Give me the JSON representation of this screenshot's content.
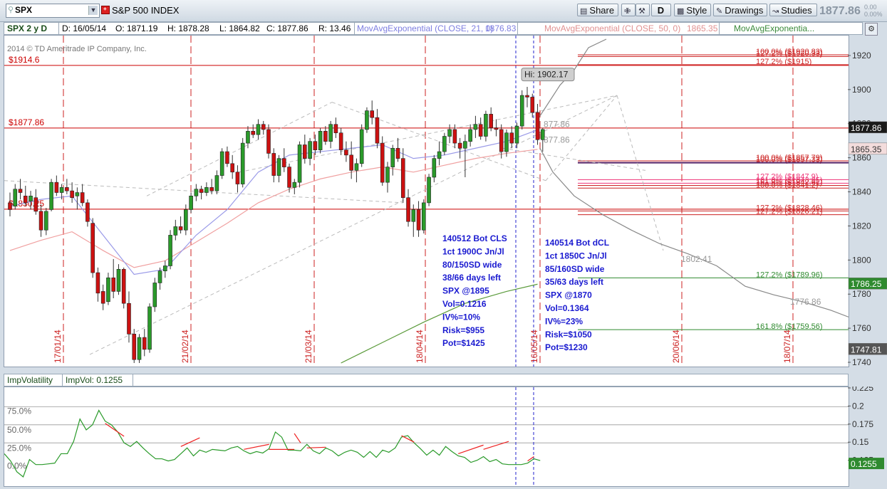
{
  "toolbar": {
    "symbol": "SPX",
    "index_name": "S&P 500 INDEX",
    "share_label": "Share",
    "d_label": "D",
    "style_label": "Style",
    "drawings_label": "Drawings",
    "studies_label": "Studies",
    "last_price": "1877.86",
    "change_abs": "0.00",
    "change_pct": "0.00%"
  },
  "header": {
    "period": "SPX 2 y D",
    "date": "D: 16/05/14",
    "open": "O: 1871.19",
    "high": "H: 1878.28",
    "low": "L: 1864.82",
    "close": "C: 1877.86",
    "range": "R: 13.46",
    "ema21_label": "MovAvgExponential (CLOSE, 21, 0)",
    "ema21_value": "1876.83",
    "ema50_label": "MovAvgExponential (CLOSE, 50, 0)",
    "ema50_value": "1865.35",
    "ema_other_label": "MovAvgExponentia..."
  },
  "chart_data": [
    {
      "type": "candlestick",
      "copyright": "2014 © TD Ameritrade IP Company, Inc.",
      "ylim": [
        1740,
        1930
      ],
      "y_ticks": [
        1740,
        1760,
        1780,
        1800,
        1820,
        1840,
        1860,
        1880,
        1900,
        1920
      ],
      "x_date_labels": [
        "17/01/14",
        "21/02/14",
        "21/03/14",
        "18/04/14",
        "16/05/14",
        "20/06/14",
        "18/07/14"
      ],
      "price_tags": [
        {
          "value": "1877.86",
          "color": "#1a1a1a"
        },
        {
          "value": "1865.35",
          "color": "#f3dcdc"
        },
        {
          "value": "1786.25",
          "color": "#2f8a2f"
        },
        {
          "value": "1747.81",
          "color": "#555555"
        }
      ],
      "hi_callout": "Hi: 1902.17",
      "level_lines": [
        {
          "label": "$1914.6",
          "value": 1914.6,
          "color": "#cc0000"
        },
        {
          "label": "$1877.86",
          "value": 1877.86,
          "color": "#cc0000"
        },
        {
          "label": "$1830.25",
          "value": 1830.25,
          "color": "#cc0000"
        }
      ],
      "fib_labels": [
        {
          "text": "100.0%  ($1920.83)",
          "value": 1920.8,
          "color": "#cc2222"
        },
        {
          "text": "127.2%  ($1920.33)",
          "value": 1919.8,
          "color": "#cc2222"
        },
        {
          "text": "127.2%  ($1915)",
          "value": 1915,
          "color": "#cc2222"
        },
        {
          "text": "100.0%  ($1857.79)",
          "value": 1858.6,
          "color": "#cc2222"
        },
        {
          "text": "100.0%  ($1857.33)",
          "value": 1857.5,
          "color": "#cc2222"
        },
        {
          "text": "127.2%  ($1847.9)",
          "value": 1847.6,
          "color": "#ee3377"
        },
        {
          "text": "161.8%  ($1843.95)",
          "value": 1845.5,
          "color": "#ee3377"
        },
        {
          "text": "161.8%  ($1842.61)",
          "value": 1844.2,
          "color": "#cc2222"
        },
        {
          "text": "100.0%  ($1841.2)",
          "value": 1842.6,
          "color": "#cc2222"
        },
        {
          "text": "127.2%  ($1828.46)",
          "value": 1829.2,
          "color": "#cc2222"
        },
        {
          "text": "127.2%  ($1826.21)",
          "value": 1827,
          "color": "#cc2222"
        },
        {
          "text": "127.2%  ($1789.96)",
          "value": 1789.96,
          "color": "#2f8a2f"
        },
        {
          "text": "161.8%  ($1759.56)",
          "value": 1759.56,
          "color": "#2f8a2f"
        }
      ],
      "projection_labels": [
        {
          "text": "877.86",
          "value": 1880
        },
        {
          "text": "877.86",
          "value": 1871
        },
        {
          "text": "1802.41",
          "value": 1801
        },
        {
          "text": "1776.86",
          "value": 1776
        }
      ],
      "notes": [
        {
          "lines": [
            "140512 Bot CLS",
            "1ct 1900C Jn/Jl",
            "80/150SD wide",
            "38/66 days left",
            "SPX @1895",
            "Vol=0.1216",
            "IV%=10%",
            "Risk=$955",
            "Pot=$1425"
          ]
        },
        {
          "lines": [
            "140514 Bot dCL",
            "1ct 1850C Jn/Jl",
            "85/160SD wide",
            "35/63 days left",
            "SPX @1870",
            "Vol=0.1364",
            "IV%=23%",
            "Risk=$1050",
            "Pot=$1230"
          ]
        }
      ],
      "candles": [
        [
          1834,
          1840,
          1826,
          1830
        ],
        [
          1832,
          1845,
          1830,
          1842
        ],
        [
          1842,
          1848,
          1836,
          1840
        ],
        [
          1838,
          1844,
          1832,
          1834
        ],
        [
          1835,
          1841,
          1830,
          1838
        ],
        [
          1837,
          1842,
          1827,
          1829
        ],
        [
          1829,
          1833,
          1814,
          1818
        ],
        [
          1818,
          1831,
          1815,
          1829
        ],
        [
          1830,
          1848,
          1829,
          1846
        ],
        [
          1846,
          1850,
          1838,
          1840
        ],
        [
          1840,
          1845,
          1836,
          1843
        ],
        [
          1843,
          1848,
          1839,
          1841
        ],
        [
          1841,
          1846,
          1834,
          1837
        ],
        [
          1838,
          1843,
          1830,
          1840
        ],
        [
          1840,
          1845,
          1832,
          1834
        ],
        [
          1834,
          1836,
          1820,
          1823
        ],
        [
          1822,
          1825,
          1790,
          1793
        ],
        [
          1793,
          1796,
          1776,
          1781
        ],
        [
          1782,
          1786,
          1771,
          1775
        ],
        [
          1776,
          1793,
          1774,
          1790
        ],
        [
          1790,
          1801,
          1778,
          1782
        ],
        [
          1782,
          1798,
          1780,
          1795
        ],
        [
          1795,
          1796,
          1772,
          1775
        ],
        [
          1775,
          1782,
          1752,
          1757
        ],
        [
          1757,
          1760,
          1740,
          1742
        ],
        [
          1742,
          1757,
          1740,
          1755
        ],
        [
          1755,
          1760,
          1744,
          1748
        ],
        [
          1748,
          1775,
          1746,
          1773
        ],
        [
          1773,
          1790,
          1770,
          1787
        ],
        [
          1787,
          1796,
          1783,
          1794
        ],
        [
          1794,
          1800,
          1790,
          1797
        ],
        [
          1797,
          1818,
          1795,
          1815
        ],
        [
          1815,
          1824,
          1812,
          1820
        ],
        [
          1820,
          1826,
          1816,
          1818
        ],
        [
          1818,
          1833,
          1815,
          1830
        ],
        [
          1830,
          1840,
          1828,
          1838
        ],
        [
          1838,
          1845,
          1835,
          1842
        ],
        [
          1842,
          1844,
          1836,
          1840
        ],
        [
          1840,
          1846,
          1838,
          1843
        ],
        [
          1843,
          1848,
          1839,
          1841
        ],
        [
          1841,
          1853,
          1839,
          1850
        ],
        [
          1850,
          1866,
          1848,
          1864
        ],
        [
          1864,
          1867,
          1855,
          1857
        ],
        [
          1857,
          1862,
          1848,
          1852
        ],
        [
          1852,
          1856,
          1840,
          1845
        ],
        [
          1845,
          1872,
          1843,
          1869
        ],
        [
          1869,
          1879,
          1866,
          1876
        ],
        [
          1876,
          1880,
          1872,
          1874
        ],
        [
          1874,
          1883,
          1871,
          1880
        ],
        [
          1880,
          1882,
          1874,
          1877
        ],
        [
          1877,
          1880,
          1860,
          1863
        ],
        [
          1863,
          1866,
          1846,
          1850
        ],
        [
          1850,
          1862,
          1846,
          1860
        ],
        [
          1860,
          1866,
          1852,
          1855
        ],
        [
          1855,
          1857,
          1840,
          1843
        ],
        [
          1843,
          1848,
          1839,
          1846
        ],
        [
          1846,
          1870,
          1843,
          1868
        ],
        [
          1868,
          1874,
          1857,
          1860
        ],
        [
          1860,
          1872,
          1856,
          1870
        ],
        [
          1870,
          1874,
          1862,
          1865
        ],
        [
          1865,
          1878,
          1863,
          1876
        ],
        [
          1876,
          1879,
          1868,
          1870
        ],
        [
          1870,
          1882,
          1866,
          1880
        ],
        [
          1880,
          1884,
          1872,
          1875
        ],
        [
          1875,
          1878,
          1862,
          1865
        ],
        [
          1865,
          1870,
          1858,
          1862
        ],
        [
          1862,
          1870,
          1848,
          1853
        ],
        [
          1853,
          1860,
          1846,
          1857
        ],
        [
          1857,
          1880,
          1855,
          1877
        ],
        [
          1877,
          1890,
          1875,
          1888
        ],
        [
          1888,
          1894,
          1880,
          1884
        ],
        [
          1884,
          1889,
          1866,
          1869
        ],
        [
          1869,
          1873,
          1844,
          1846
        ],
        [
          1846,
          1858,
          1840,
          1855
        ],
        [
          1855,
          1868,
          1850,
          1866
        ],
        [
          1866,
          1872,
          1858,
          1860
        ],
        [
          1860,
          1866,
          1834,
          1837
        ],
        [
          1837,
          1842,
          1820,
          1823
        ],
        [
          1823,
          1833,
          1814,
          1830
        ],
        [
          1830,
          1835,
          1814,
          1818
        ],
        [
          1818,
          1836,
          1816,
          1834
        ],
        [
          1834,
          1851,
          1832,
          1849
        ],
        [
          1849,
          1862,
          1846,
          1860
        ],
        [
          1860,
          1870,
          1856,
          1864
        ],
        [
          1864,
          1875,
          1862,
          1873
        ],
        [
          1873,
          1880,
          1869,
          1877
        ],
        [
          1877,
          1880,
          1866,
          1869
        ],
        [
          1869,
          1872,
          1860,
          1866
        ],
        [
          1866,
          1874,
          1849,
          1870
        ],
        [
          1870,
          1880,
          1867,
          1877
        ],
        [
          1877,
          1885,
          1872,
          1880
        ],
        [
          1880,
          1884,
          1871,
          1873
        ],
        [
          1873,
          1888,
          1870,
          1886
        ],
        [
          1886,
          1890,
          1876,
          1878
        ],
        [
          1878,
          1883,
          1873,
          1877
        ],
        [
          1877,
          1880,
          1860,
          1864
        ],
        [
          1864,
          1877,
          1861,
          1875
        ],
        [
          1875,
          1879,
          1866,
          1869
        ],
        [
          1869,
          1881,
          1866,
          1879
        ],
        [
          1879,
          1900,
          1877,
          1897
        ],
        [
          1897,
          1902,
          1890,
          1896
        ],
        [
          1896,
          1898,
          1884,
          1887
        ],
        [
          1887,
          1892,
          1868,
          1871
        ],
        [
          1871,
          1878,
          1864,
          1877
        ]
      ],
      "ema21": [
        [
          0,
          1832
        ],
        [
          6,
          1836
        ],
        [
          12,
          1838
        ],
        [
          18,
          1815
        ],
        [
          24,
          1792
        ],
        [
          30,
          1795
        ],
        [
          36,
          1815
        ],
        [
          42,
          1830
        ],
        [
          48,
          1852
        ],
        [
          54,
          1862
        ],
        [
          60,
          1864
        ],
        [
          66,
          1866
        ],
        [
          72,
          1868
        ],
        [
          78,
          1860
        ],
        [
          84,
          1862
        ],
        [
          90,
          1866
        ],
        [
          96,
          1870
        ],
        [
          102,
          1876.8
        ]
      ],
      "ema50": [
        [
          0,
          1806
        ],
        [
          6,
          1812
        ],
        [
          12,
          1817
        ],
        [
          18,
          1806
        ],
        [
          24,
          1796
        ],
        [
          30,
          1800
        ],
        [
          36,
          1811
        ],
        [
          42,
          1822
        ],
        [
          48,
          1834
        ],
        [
          54,
          1842
        ],
        [
          60,
          1848
        ],
        [
          66,
          1852
        ],
        [
          72,
          1855
        ],
        [
          78,
          1852
        ],
        [
          84,
          1856
        ],
        [
          90,
          1860
        ],
        [
          96,
          1863
        ],
        [
          102,
          1865.35
        ]
      ],
      "ema_long": [
        [
          64,
          1740
        ],
        [
          72,
          1752
        ],
        [
          80,
          1764
        ],
        [
          88,
          1775
        ],
        [
          96,
          1782
        ],
        [
          102,
          1786.25
        ]
      ]
    },
    {
      "type": "line",
      "series_names": [
        "ImpVolatility",
        "ImpVol: 0.1255"
      ],
      "right_ticks": [
        0.125,
        0.15,
        0.175,
        0.2,
        0.225
      ],
      "left_ticks": [
        "0.0%",
        "25.0%",
        "50.0%",
        "75.0%"
      ],
      "ylim": [
        0.1,
        0.225
      ],
      "last_value": "0.1255",
      "values": [
        0.135,
        0.125,
        0.11,
        0.103,
        0.127,
        0.12,
        0.12,
        0.121,
        0.122,
        0.135,
        0.135,
        0.152,
        0.183,
        0.168,
        0.175,
        0.195,
        0.18,
        0.175,
        0.165,
        0.15,
        0.145,
        0.152,
        0.143,
        0.135,
        0.128,
        0.128,
        0.125,
        0.127,
        0.135,
        0.143,
        0.132,
        0.14,
        0.137,
        0.141,
        0.14,
        0.139,
        0.143,
        0.145,
        0.139,
        0.135,
        0.138,
        0.136,
        0.142,
        0.165,
        0.158,
        0.14,
        0.14,
        0.139,
        0.148,
        0.139,
        0.135,
        0.143,
        0.139,
        0.132,
        0.137,
        0.14,
        0.137,
        0.13,
        0.138,
        0.13,
        0.14,
        0.137,
        0.143,
        0.158,
        0.16,
        0.15,
        0.142,
        0.133,
        0.14,
        0.133,
        0.145,
        0.138,
        0.132,
        0.13,
        0.123,
        0.126,
        0.131,
        0.124,
        0.127,
        0.121,
        0.12,
        0.12,
        0.12,
        0.122,
        0.128,
        0.1255
      ]
    }
  ]
}
